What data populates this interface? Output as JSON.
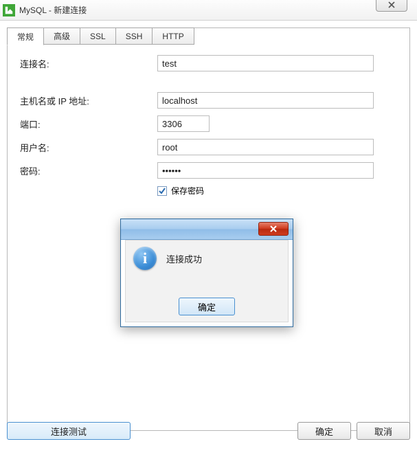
{
  "window": {
    "title": "MySQL - 新建连接"
  },
  "tabs": {
    "general": "常规",
    "advanced": "高级",
    "ssl": "SSL",
    "ssh": "SSH",
    "http": "HTTP"
  },
  "form": {
    "connection_name_label": "连接名:",
    "connection_name_value": "test",
    "hostname_label": "主机名或 IP 地址:",
    "hostname_value": "localhost",
    "port_label": "端口:",
    "port_value": "3306",
    "username_label": "用户名:",
    "username_value": "root",
    "password_label": "密码:",
    "password_value": "••••••",
    "save_password_label": "保存密码",
    "save_password_checked": true
  },
  "buttons": {
    "test_connection": "连接测试",
    "ok": "确定",
    "cancel": "取消"
  },
  "modal": {
    "message": "连接成功",
    "ok": "确定"
  }
}
